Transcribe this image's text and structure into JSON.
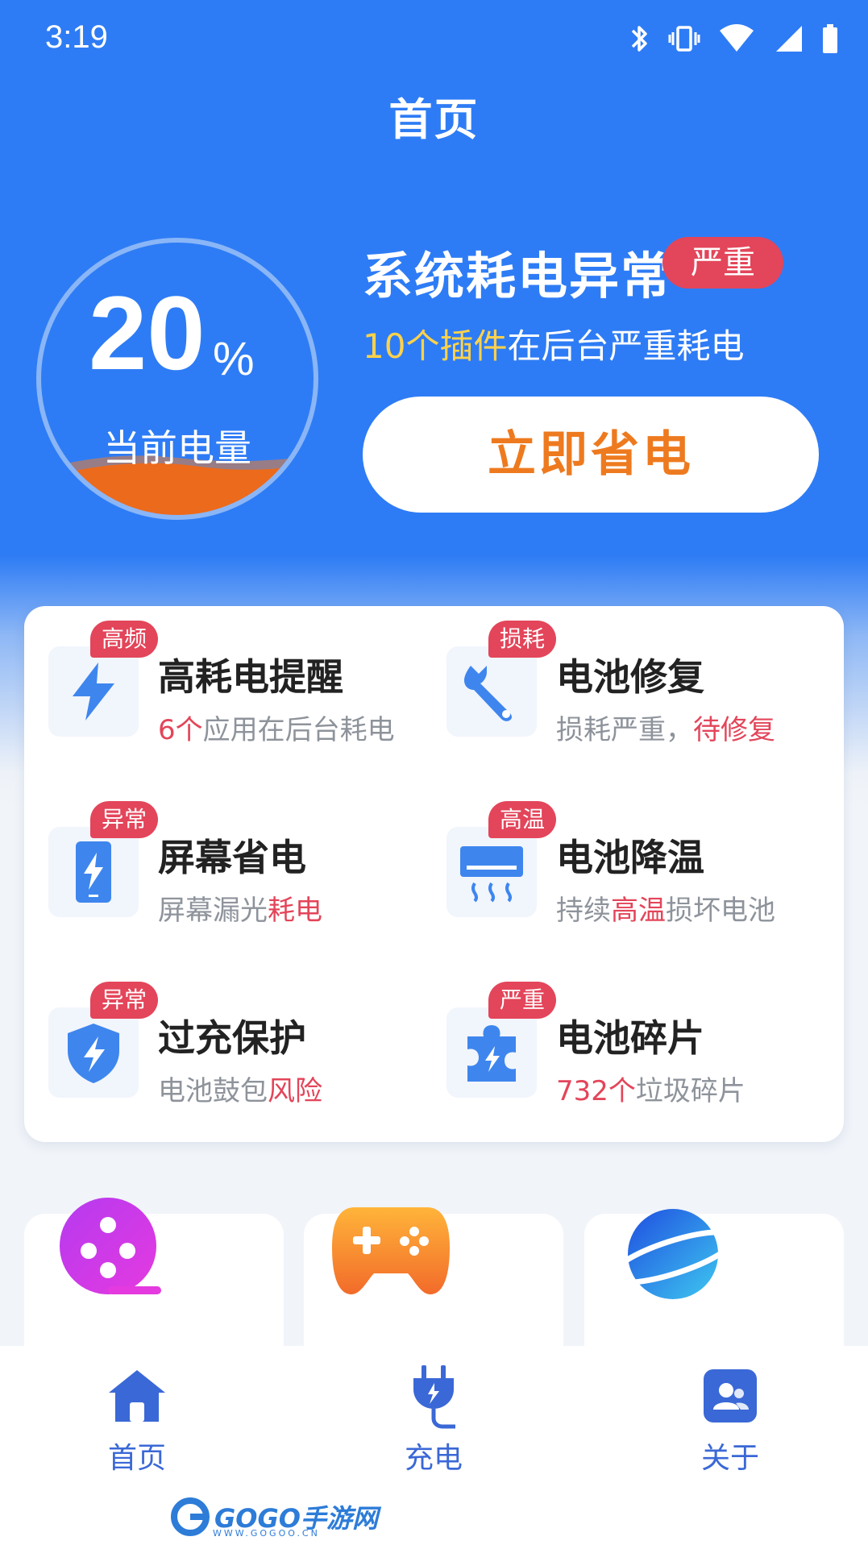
{
  "status_bar": {
    "time": "3:19"
  },
  "page_title": "首页",
  "battery": {
    "percent": "20",
    "unit": "%",
    "label": "当前电量",
    "level": 0.2
  },
  "alert": {
    "title": "系统耗电异常",
    "severity": "严重",
    "sub_highlight": "10个插件",
    "sub_rest": "在后台严重耗电",
    "action_label": "立即省电"
  },
  "tools": [
    {
      "badge": "高频",
      "name": "高耗电提醒",
      "desc_pre": "",
      "desc_red": "6个",
      "desc_post": "应用在后台耗电",
      "icon": "lightning-icon"
    },
    {
      "badge": "损耗",
      "name": "电池修复",
      "desc_pre": "损耗严重，",
      "desc_red": "待修复",
      "desc_post": "",
      "icon": "wrench-icon"
    },
    {
      "badge": "异常",
      "name": "屏幕省电",
      "desc_pre": "屏幕漏光",
      "desc_red": "耗电",
      "desc_post": "",
      "icon": "phone-lightning-icon"
    },
    {
      "badge": "高温",
      "name": "电池降温",
      "desc_pre": "持续",
      "desc_red": "高温",
      "desc_post": "损坏电池",
      "icon": "air-conditioner-icon"
    },
    {
      "badge": "异常",
      "name": "过充保护",
      "desc_pre": "电池鼓包",
      "desc_red": "风险",
      "desc_post": "",
      "icon": "shield-lightning-icon"
    },
    {
      "badge": "严重",
      "name": "电池碎片",
      "desc_pre": "",
      "desc_red": "732个",
      "desc_post": "垃圾碎片",
      "icon": "puzzle-icon"
    }
  ],
  "features": [
    {
      "icon": "film-reel-icon"
    },
    {
      "icon": "gamepad-icon"
    },
    {
      "icon": "planet-icon"
    }
  ],
  "nav": [
    {
      "label": "首页",
      "icon": "home-icon"
    },
    {
      "label": "充电",
      "icon": "plug-icon"
    },
    {
      "label": "关于",
      "icon": "about-users-icon"
    }
  ],
  "watermark": {
    "brand": "GOGO手游网",
    "url": "WWW.GOGOO.CN"
  },
  "colors": {
    "primary": "#2e7cf5",
    "danger": "#e3455a",
    "accent_orange": "#ee7a1f",
    "highlight_yellow": "#ffd24a",
    "nav_blue": "#3a68d6"
  }
}
